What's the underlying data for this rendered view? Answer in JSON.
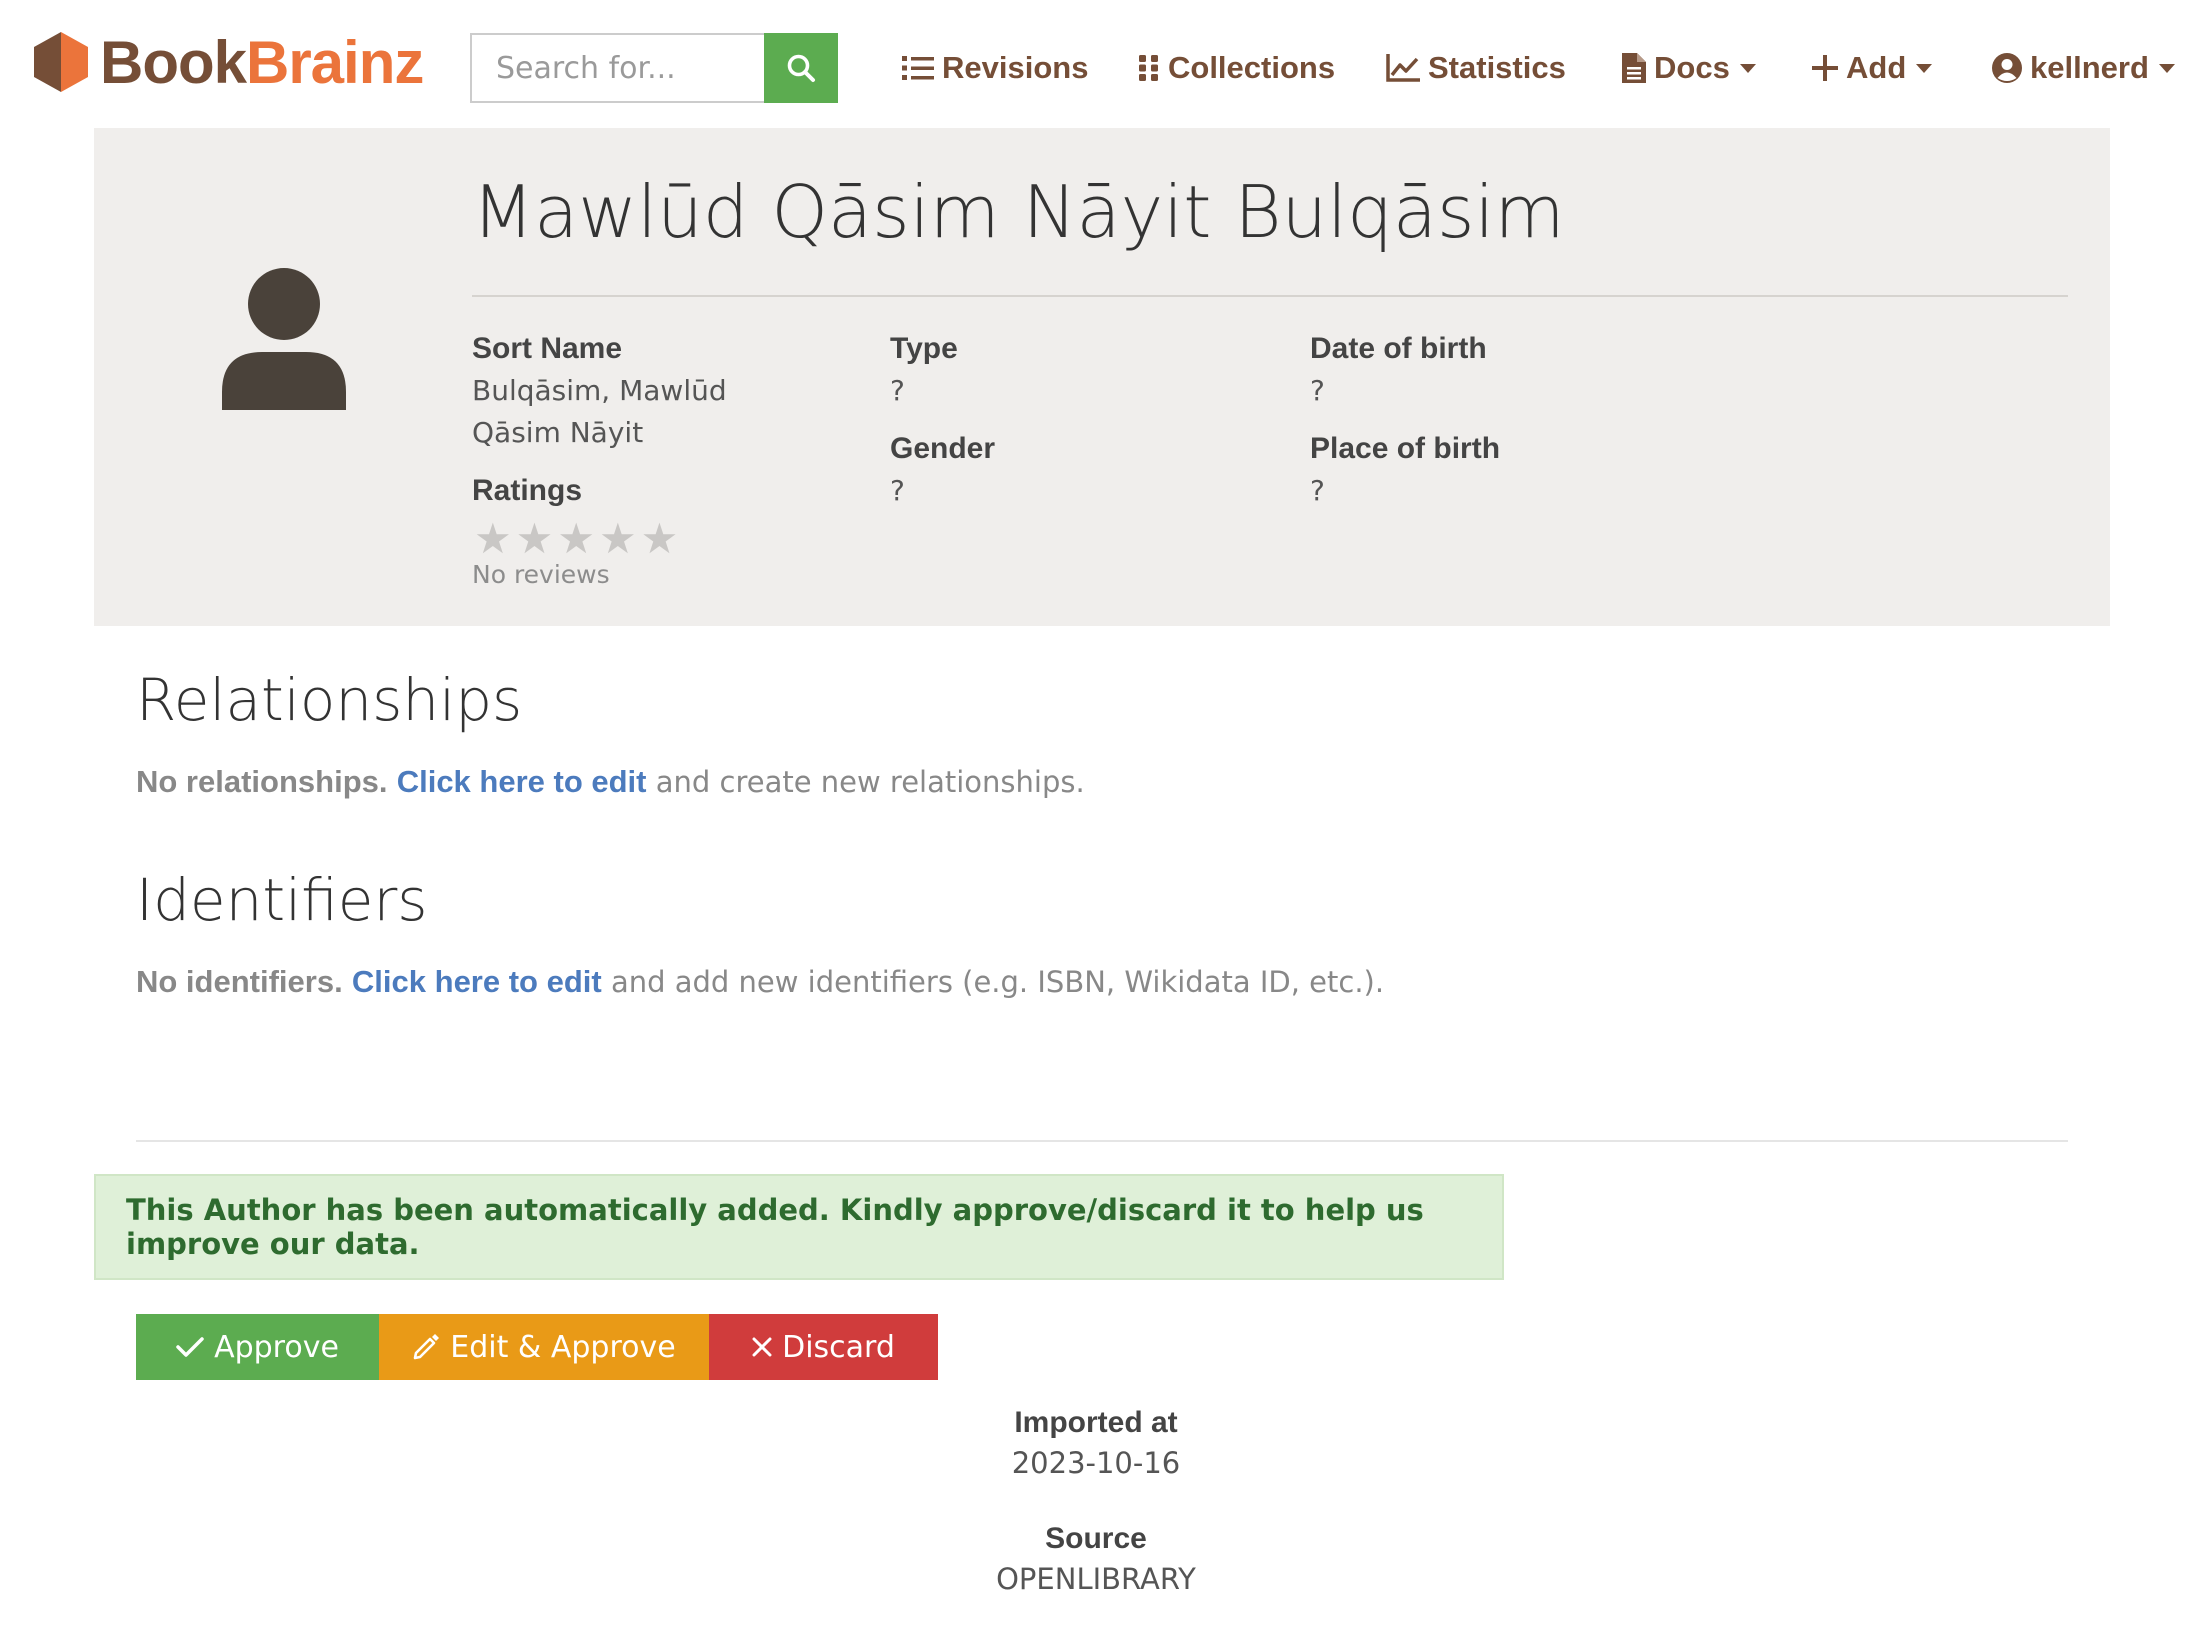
{
  "brand": {
    "part1": "Book",
    "part2": "Brainz",
    "color_dark": "#754e37",
    "color_orange": "#eb743b"
  },
  "search": {
    "placeholder": "Search for...",
    "button_icon": "search-icon"
  },
  "nav": {
    "revisions": "Revisions",
    "collections": "Collections",
    "statistics": "Statistics",
    "docs": "Docs",
    "add": "Add",
    "user": "kellnerd"
  },
  "entity": {
    "name": "Mawlūd Qāsim Nāyit Bulqāsim",
    "avatar_icon": "user-silhouette-icon",
    "sort_name_label": "Sort Name",
    "sort_name_line1": "Bulqāsim, Mawlūd",
    "sort_name_line2": "Qāsim Nāyit",
    "type_label": "Type",
    "type_value": "?",
    "gender_label": "Gender",
    "gender_value": "?",
    "dob_label": "Date of birth",
    "dob_value": "?",
    "pob_label": "Place of birth",
    "pob_value": "?",
    "ratings_label": "Ratings",
    "rating_stars": 0,
    "rating_max": 5,
    "no_reviews": "No reviews"
  },
  "relationships": {
    "title": "Relationships",
    "empty_strong": "No relationships.",
    "link": "Click here to edit",
    "rest": "and create new relationships."
  },
  "identifiers": {
    "title": "Identifiers",
    "empty_strong": "No identifiers.",
    "link": "Click here to edit",
    "rest": "and add new identifiers (e.g. ISBN, Wikidata ID, etc.)."
  },
  "alert": {
    "text": "This Author has been automatically added. Kindly approve/discard it to help us improve our data."
  },
  "actions": {
    "approve": "Approve",
    "edit_approve": "Edit & Approve",
    "discard": "Discard"
  },
  "import_meta": {
    "imported_label": "Imported at",
    "imported_value": "2023-10-16",
    "source_label": "Source",
    "source_value": "OPENLIBRARY"
  }
}
